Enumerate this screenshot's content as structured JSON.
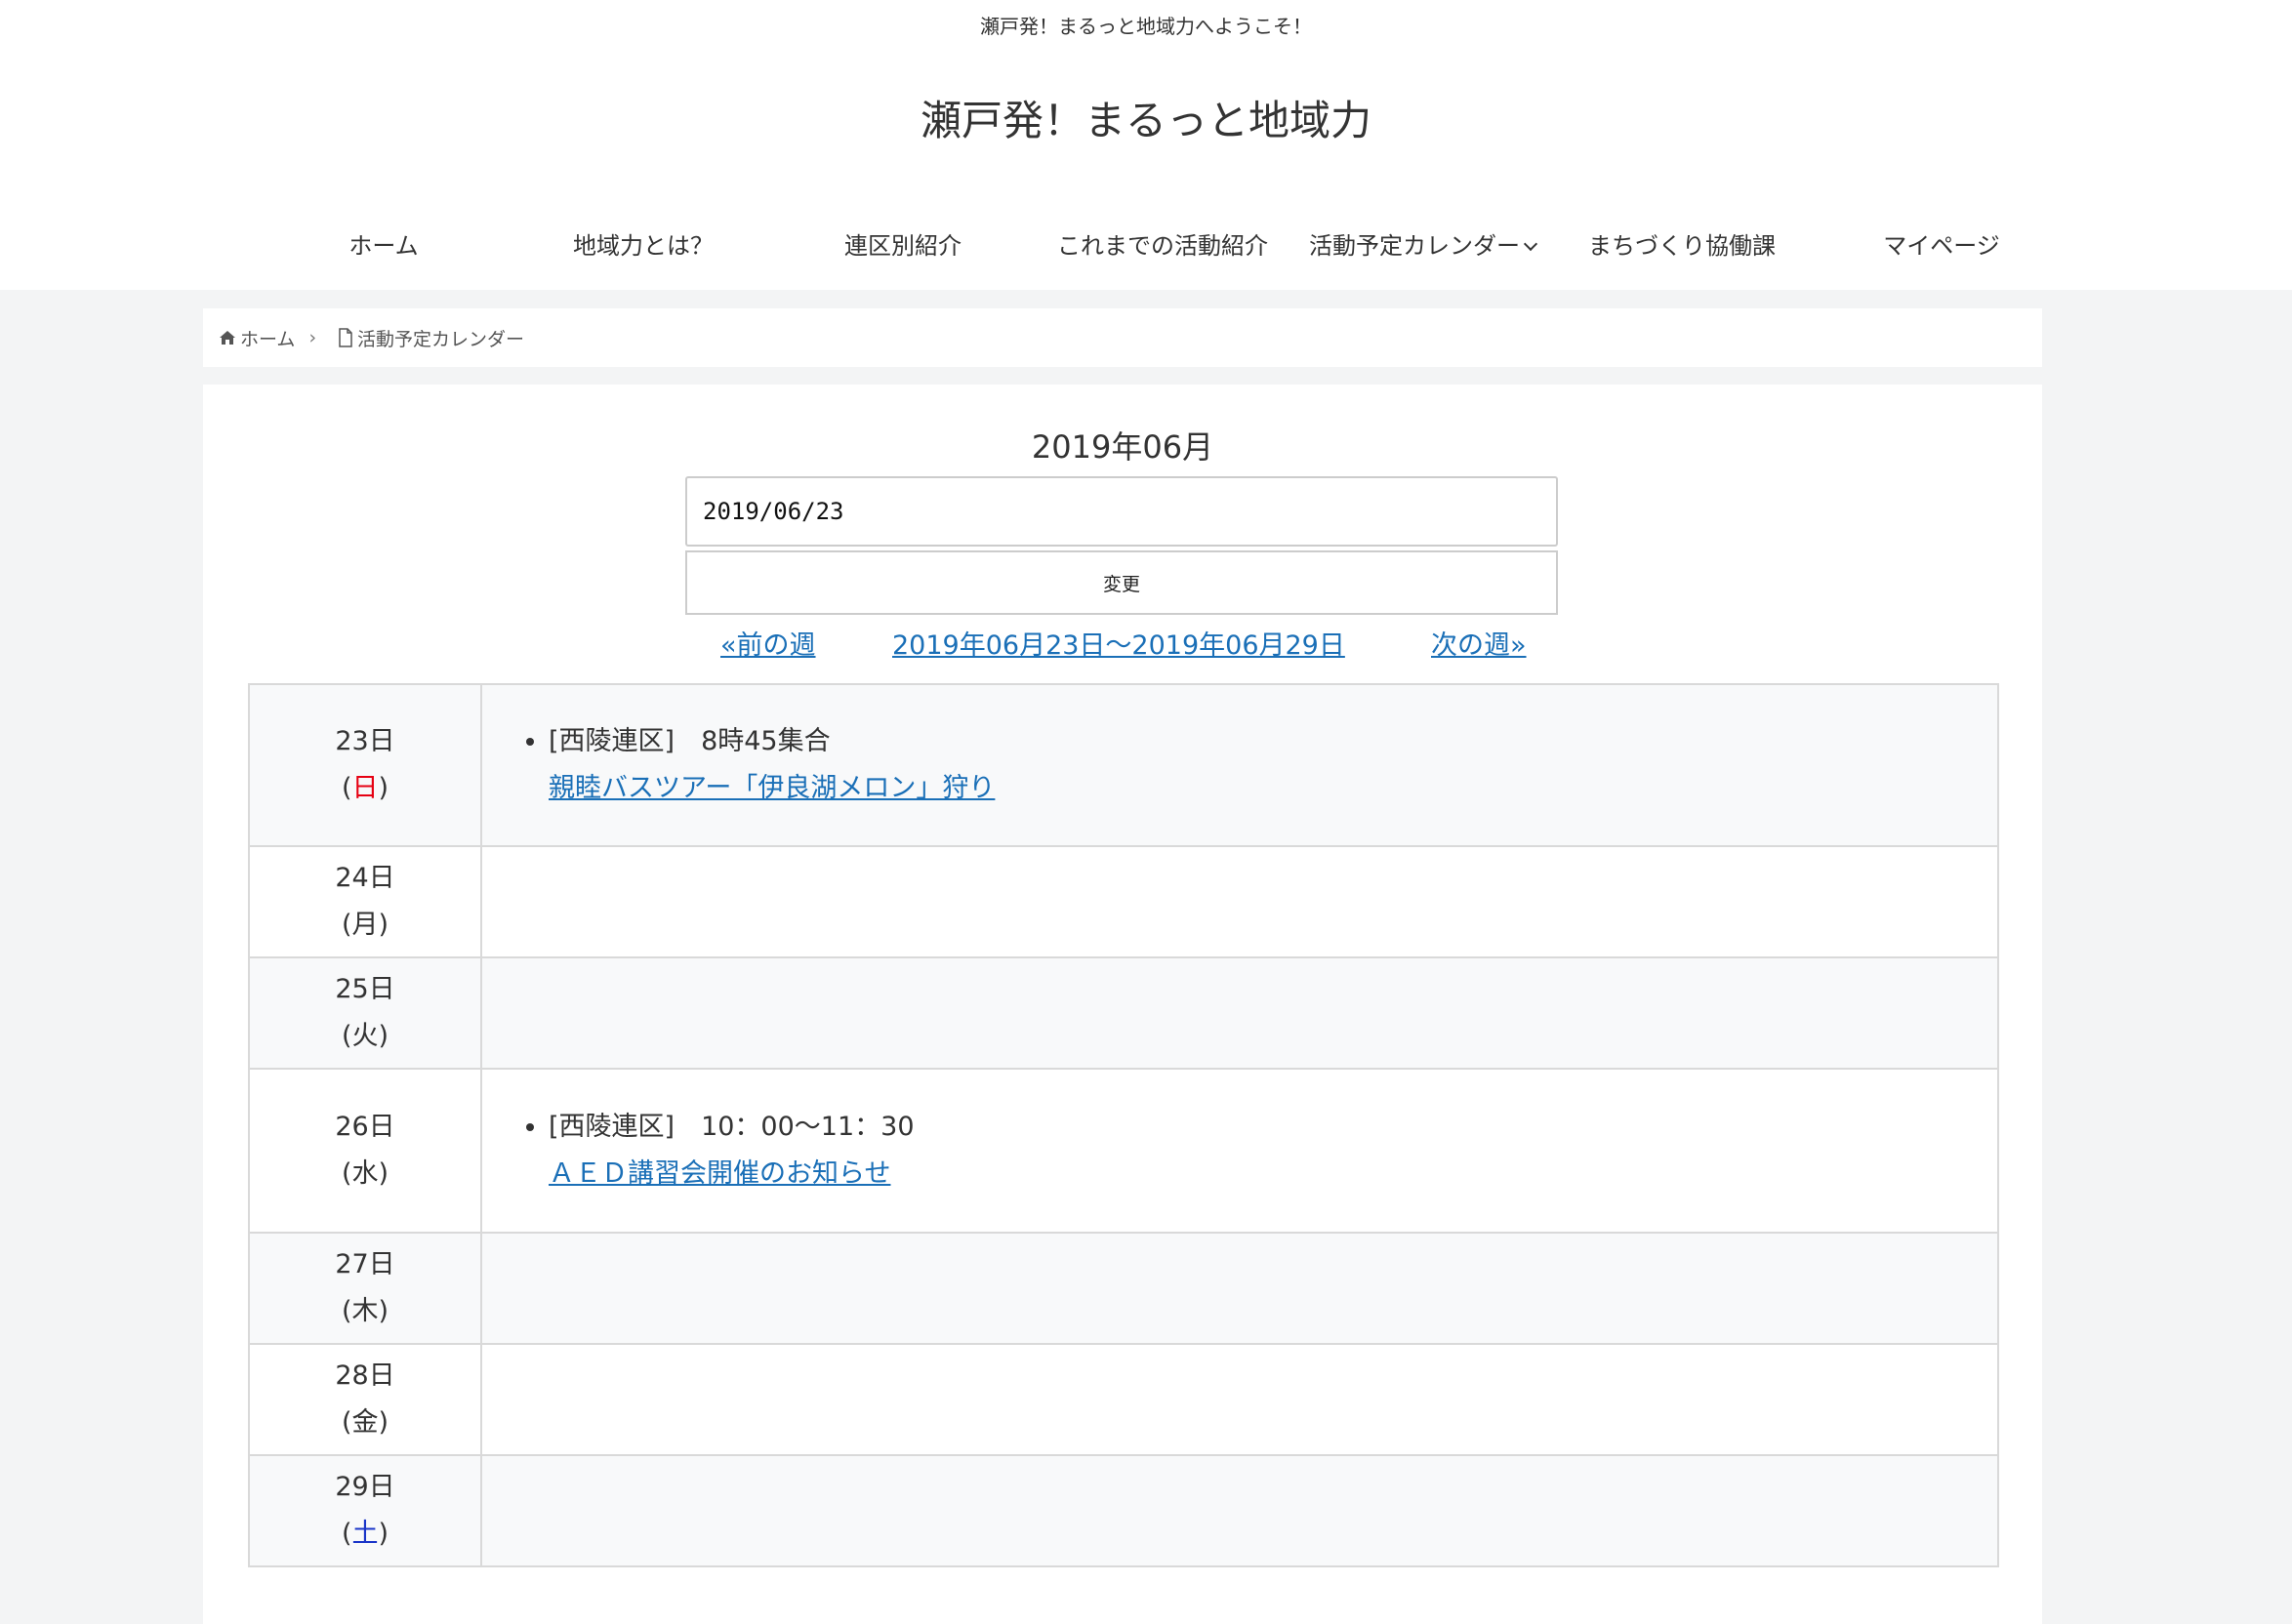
{
  "header": {
    "tagline": "瀬戸発！まるっと地域力へようこそ！",
    "site_title": "瀬戸発！まるっと地域力"
  },
  "nav": [
    {
      "label": "ホーム"
    },
    {
      "label": "地域力とは？"
    },
    {
      "label": "連区別紹介"
    },
    {
      "label": "これまでの活動紹介"
    },
    {
      "label": "活動予定カレンダー",
      "has_dropdown": true
    },
    {
      "label": "まちづくり協働課"
    },
    {
      "label": "マイページ"
    }
  ],
  "breadcrumb": {
    "home": "ホーム",
    "current": "活動予定カレンダー",
    "separator": "›"
  },
  "calendar": {
    "month_title": "2019年06月",
    "date_value": "2019/06/23",
    "change_label": "変更",
    "prev_week": "«前の週",
    "range": "2019年06月23日〜2019年06月29日",
    "next_week": "次の週»",
    "days": [
      {
        "date": "23日",
        "weekday": "日",
        "events": [
          {
            "info": "[西陵連区]　8時45集合",
            "title": "親睦バスツアー「伊良湖メロン」狩り"
          }
        ]
      },
      {
        "date": "24日",
        "weekday": "月",
        "events": []
      },
      {
        "date": "25日",
        "weekday": "火",
        "events": []
      },
      {
        "date": "26日",
        "weekday": "水",
        "events": [
          {
            "info": "[西陵連区]　10：00〜11：30",
            "title": "ＡＥＤ講習会開催のお知らせ"
          }
        ]
      },
      {
        "date": "27日",
        "weekday": "木",
        "events": []
      },
      {
        "date": "28日",
        "weekday": "金",
        "events": []
      },
      {
        "date": "29日",
        "weekday": "土",
        "events": []
      }
    ]
  },
  "colors": {
    "link": "#1a6fb7",
    "sunday": "#e60012",
    "saturday": "#1a35c8"
  }
}
